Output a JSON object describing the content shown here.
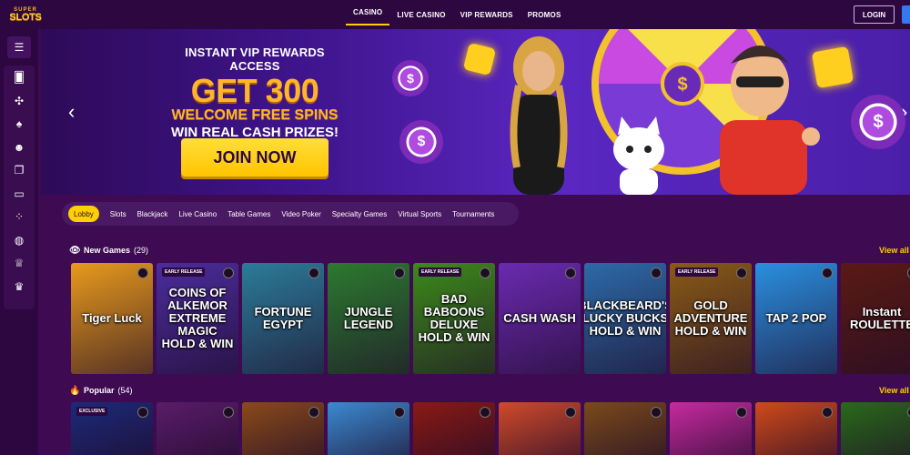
{
  "brand": {
    "logo_top": "SUPER",
    "logo_bottom": "SLOTS"
  },
  "nav": [
    {
      "label": "CASINO",
      "active": true
    },
    {
      "label": "LIVE CASINO",
      "active": false
    },
    {
      "label": "VIP REWARDS",
      "active": false
    },
    {
      "label": "PROMOS",
      "active": false
    }
  ],
  "header": {
    "login_label": "LOGIN"
  },
  "sidebar": {
    "menu_icon": "hamburger-icon",
    "icons": [
      "cards-icon",
      "crossed-arrows-icon",
      "spade-icon",
      "dealer-icon",
      "card-stack-icon",
      "laptop-icon",
      "dots-grid-icon",
      "basketball-icon",
      "trophy-icon",
      "crown-icon"
    ]
  },
  "banner": {
    "line1": "INSTANT VIP REWARDS ACCESS",
    "line2": "GET 300",
    "line3": "WELCOME FREE SPINS",
    "line4": "WIN REAL CASH PRIZES!",
    "cta": "JOIN NOW",
    "chip_symbol": "$"
  },
  "categories": [
    "Lobby",
    "Slots",
    "Blackjack",
    "Live Casino",
    "Table Games",
    "Video Poker",
    "Specialty Games",
    "Virtual Sports",
    "Tournaments"
  ],
  "new_games": {
    "title": "New Games",
    "count": "(29)",
    "view_all": "View all",
    "games": [
      {
        "name": "Tiger Luck",
        "badge": "",
        "bg": "#e89a1c"
      },
      {
        "name": "COINS OF ALKEMOR EXTREME MAGIC HOLD & WIN",
        "badge": "EARLY RELEASE",
        "bg": "#4b2c9c"
      },
      {
        "name": "FORTUNE EGYPT",
        "badge": "",
        "bg": "#2b7c9a"
      },
      {
        "name": "JUNGLE LEGEND",
        "badge": "",
        "bg": "#2c7a2f"
      },
      {
        "name": "BAD BABOONS DELUXE HOLD & WIN",
        "badge": "EARLY RELEASE",
        "bg": "#3c8a1a"
      },
      {
        "name": "CASH WASH",
        "badge": "",
        "bg": "#6a2ab0"
      },
      {
        "name": "BLACKBEARD'S LUCKY BUCKS HOLD & WIN",
        "badge": "",
        "bg": "#2c6aa8"
      },
      {
        "name": "GOLD ADVENTURE HOLD & WIN",
        "badge": "EARLY RELEASE",
        "bg": "#8a5a16"
      },
      {
        "name": "TAP 2 POP",
        "badge": "",
        "bg": "#2a8fe0"
      },
      {
        "name": "Instant ROULETTE",
        "badge": "",
        "bg": "#5a1a14"
      }
    ]
  },
  "popular": {
    "title": "Popular",
    "count": "(54)",
    "view_all": "View all",
    "games": [
      {
        "badge": "EXCLUSIVE",
        "bg": "#1c2a7a"
      },
      {
        "badge": "",
        "bg": "#5a1c6a"
      },
      {
        "badge": "",
        "bg": "#8a4a1a"
      },
      {
        "badge": "",
        "bg": "#3a8ad0"
      },
      {
        "badge": "",
        "bg": "#8a1a14"
      },
      {
        "badge": "",
        "bg": "#d04a2a"
      },
      {
        "badge": "",
        "bg": "#7a4a1a"
      },
      {
        "badge": "",
        "bg": "#c82aa0"
      },
      {
        "badge": "",
        "bg": "#d04a1a"
      },
      {
        "badge": "",
        "bg": "#2a6a1a"
      }
    ]
  },
  "colors": {
    "accent": "#ffd000",
    "background": "#3e0b53",
    "topbar": "#2c0740"
  }
}
